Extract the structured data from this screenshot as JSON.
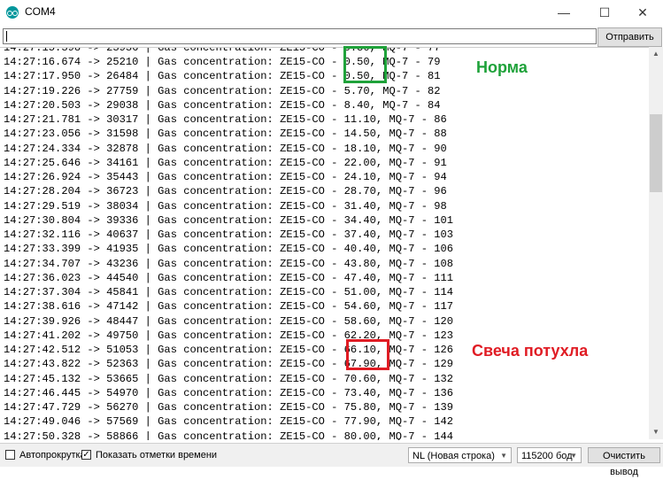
{
  "window": {
    "title": "COM4",
    "minimize": "—",
    "maximize": "☐",
    "close": "✕"
  },
  "send": {
    "value": "",
    "button_label": "Отправить"
  },
  "serial_lines": [
    "14:27:16.674 -> 25210 | Gas concentration: ZE15-CO - 0.50, MQ-7 - 79",
    "14:27:17.950 -> 26484 | Gas concentration: ZE15-CO - 0.50, MQ-7 - 81",
    "14:27:19.226 -> 27759 | Gas concentration: ZE15-CO - 5.70, MQ-7 - 82",
    "14:27:20.503 -> 29038 | Gas concentration: ZE15-CO - 8.40, MQ-7 - 84",
    "14:27:21.781 -> 30317 | Gas concentration: ZE15-CO - 11.10, MQ-7 - 86",
    "14:27:23.056 -> 31598 | Gas concentration: ZE15-CO - 14.50, MQ-7 - 88",
    "14:27:24.334 -> 32878 | Gas concentration: ZE15-CO - 18.10, MQ-7 - 90",
    "14:27:25.646 -> 34161 | Gas concentration: ZE15-CO - 22.00, MQ-7 - 91",
    "14:27:26.924 -> 35443 | Gas concentration: ZE15-CO - 24.10, MQ-7 - 94",
    "14:27:28.204 -> 36723 | Gas concentration: ZE15-CO - 28.70, MQ-7 - 96",
    "14:27:29.519 -> 38034 | Gas concentration: ZE15-CO - 31.40, MQ-7 - 98",
    "14:27:30.804 -> 39336 | Gas concentration: ZE15-CO - 34.40, MQ-7 - 101",
    "14:27:32.116 -> 40637 | Gas concentration: ZE15-CO - 37.40, MQ-7 - 103",
    "14:27:33.399 -> 41935 | Gas concentration: ZE15-CO - 40.40, MQ-7 - 106",
    "14:27:34.707 -> 43236 | Gas concentration: ZE15-CO - 43.80, MQ-7 - 108",
    "14:27:36.023 -> 44540 | Gas concentration: ZE15-CO - 47.40, MQ-7 - 111",
    "14:27:37.304 -> 45841 | Gas concentration: ZE15-CO - 51.00, MQ-7 - 114",
    "14:27:38.616 -> 47142 | Gas concentration: ZE15-CO - 54.60, MQ-7 - 117",
    "14:27:39.926 -> 48447 | Gas concentration: ZE15-CO - 58.60, MQ-7 - 120",
    "14:27:41.202 -> 49750 | Gas concentration: ZE15-CO - 62.20, MQ-7 - 123",
    "14:27:42.512 -> 51053 | Gas concentration: ZE15-CO - 66.10, MQ-7 - 126",
    "14:27:43.822 -> 52363 | Gas concentration: ZE15-CO - 67.90, MQ-7 - 129",
    "14:27:45.132 -> 53665 | Gas concentration: ZE15-CO - 70.60, MQ-7 - 132",
    "14:27:46.445 -> 54970 | Gas concentration: ZE15-CO - 73.40, MQ-7 - 136",
    "14:27:47.729 -> 56270 | Gas concentration: ZE15-CO - 75.80, MQ-7 - 139",
    "14:27:49.046 -> 57569 | Gas concentration: ZE15-CO - 77.90, MQ-7 - 142",
    "14:27:50.328 -> 58866 | Gas concentration: ZE15-CO - 80.00, MQ-7 - 144"
  ],
  "annotations": {
    "normal_label": "Норма",
    "normal_color": "#1fa23a",
    "candle_out_label": "Свеча потухла",
    "candle_out_color": "#e01c24"
  },
  "statusbar": {
    "autoscroll_label": "Автопрокрутка",
    "autoscroll_checked": false,
    "timestamps_label": "Показать отметки времени",
    "timestamps_checked": true,
    "line_ending": "NL (Новая строка)",
    "baud_rate": "115200 бод",
    "clear_button": "Очистить вывод"
  },
  "icons": {
    "app": "arduino-icon",
    "scroll_up": "scroll-up-arrow-icon",
    "scroll_down": "scroll-down-arrow-icon"
  }
}
